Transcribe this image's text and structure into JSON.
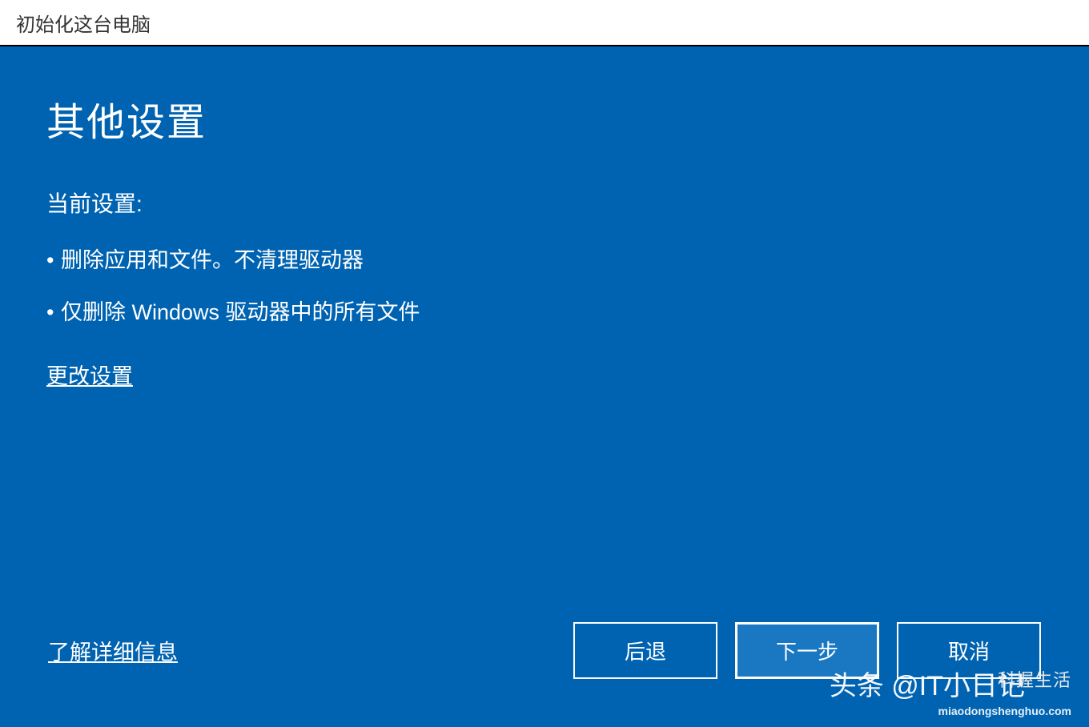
{
  "titleBar": {
    "text": "初始化这台电脑"
  },
  "main": {
    "heading": "其他设置",
    "currentSettingsLabel": "当前设置:",
    "settingsItems": [
      "删除应用和文件。不清理驱动器",
      "仅删除 Windows 驱动器中的所有文件"
    ],
    "changeSettingsLink": "更改设置"
  },
  "footer": {
    "learnMoreLink": "了解详细信息",
    "buttons": {
      "back": "后退",
      "next": "下一步",
      "cancel": "取消"
    }
  },
  "watermark": {
    "main": "头条 @IT小日记",
    "side": "科握生活",
    "url": "miaodongshenghuo.com"
  }
}
